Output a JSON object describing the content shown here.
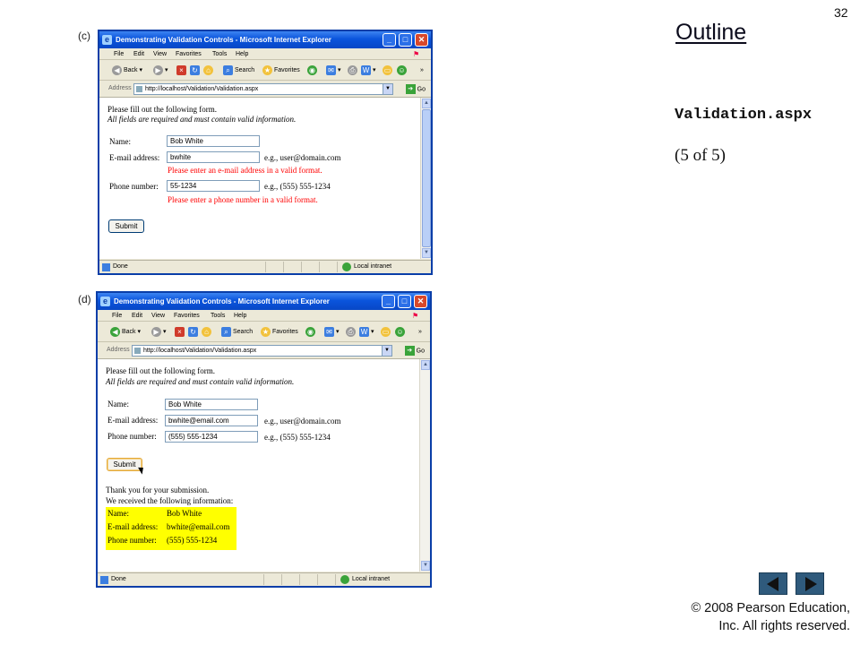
{
  "slide": {
    "number": "32",
    "outline_title": "Outline",
    "file_name": "Validation.aspx",
    "page_count": "(5 of 5)",
    "copyright_line1": "© 2008 Pearson Education,",
    "copyright_line2": "Inc.  All rights reserved."
  },
  "screenshot_c": {
    "figure_label": "(c)",
    "window_title": "Demonstrating Validation Controls - Microsoft Internet Explorer",
    "menu": [
      "File",
      "Edit",
      "View",
      "Favorites",
      "Tools",
      "Help"
    ],
    "toolbar": {
      "back": "Back",
      "search": "Search",
      "favorites": "Favorites"
    },
    "address_label": "Address",
    "address_url": "http://localhost/Validation/Validation.aspx",
    "go_label": "Go",
    "form": {
      "intro": "Please fill out the following form.",
      "intro_note": "All fields are required and must contain valid information.",
      "name_label": "Name:",
      "name_value": "Bob White",
      "email_label": "E-mail address:",
      "email_value": "bwhite",
      "email_example": "e.g., user@domain.com",
      "email_error": "Please enter an e-mail address in a valid format.",
      "phone_label": "Phone number:",
      "phone_value": "55-1234",
      "phone_example": "e.g., (555) 555-1234",
      "phone_error": "Please enter a phone number in a valid format.",
      "submit_label": "Submit"
    },
    "status": {
      "text": "Done",
      "zone": "Local intranet"
    }
  },
  "screenshot_d": {
    "figure_label": "(d)",
    "window_title": "Demonstrating Validation Controls - Microsoft Internet Explorer",
    "menu": [
      "File",
      "Edit",
      "View",
      "Favorites",
      "Tools",
      "Help"
    ],
    "toolbar": {
      "back": "Back",
      "search": "Search",
      "favorites": "Favorites"
    },
    "address_label": "Address",
    "address_url": "http://localhost/Validation/Validation.aspx",
    "go_label": "Go",
    "form": {
      "intro": "Please fill out the following form.",
      "intro_note": "All fields are required and must contain valid information.",
      "name_label": "Name:",
      "name_value": "Bob White",
      "email_label": "E-mail address:",
      "email_value": "bwhite@email.com",
      "email_example": "e.g., user@domain.com",
      "phone_label": "Phone number:",
      "phone_value": "(555) 555-1234",
      "phone_example": "e.g., (555) 555-1234",
      "submit_label": "Submit"
    },
    "result": {
      "thanks": "Thank you for your submission.",
      "received": "We received the following information:",
      "rows": [
        {
          "key": "Name:",
          "value": "Bob White"
        },
        {
          "key": "E-mail address:",
          "value": "bwhite@email.com"
        },
        {
          "key": "Phone number:",
          "value": "(555) 555-1234"
        }
      ]
    },
    "status": {
      "text": "Done",
      "zone": "Local intranet"
    }
  },
  "colors": {
    "titlebar": "#0a54dc",
    "error": "#ff0000",
    "highlight": "#ffff00",
    "nav_button": "#2f5a7c"
  }
}
